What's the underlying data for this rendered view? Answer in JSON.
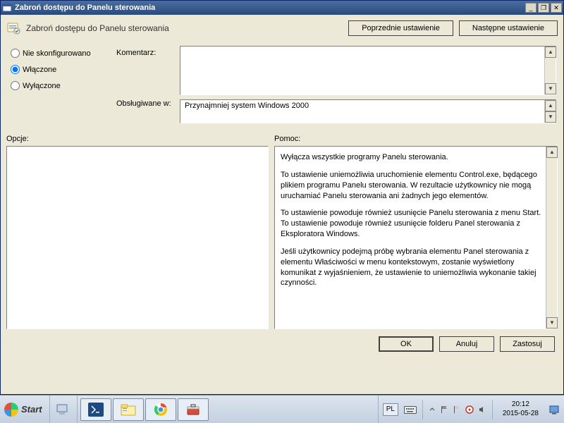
{
  "window": {
    "title": "Zabroń dostępu do Panelu sterowania"
  },
  "header": {
    "policy_title": "Zabroń dostępu do Panelu sterowania",
    "prev_btn": "Poprzednie ustawienie",
    "next_btn": "Następne ustawienie"
  },
  "state": {
    "option_not_configured": "Nie skonfigurowano",
    "option_enabled": "Włączone",
    "option_disabled": "Wyłączone",
    "selected": "enabled"
  },
  "labels": {
    "comment": "Komentarz:",
    "supported": "Obsługiwane w:",
    "options": "Opcje:",
    "help": "Pomoc:"
  },
  "supported_text": "Przynajmniej system Windows 2000",
  "help": {
    "p1": "Wyłącza wszystkie programy Panelu sterowania.",
    "p2": "To ustawienie uniemożliwia uruchomienie elementu Control.exe, będącego plikiem programu Panelu sterowania. W rezultacie użytkownicy nie mogą uruchamiać Panelu sterowania ani żadnych jego elementów.",
    "p3": "To ustawienie powoduje również usunięcie Panelu sterowania z menu Start. To ustawienie powoduje również usunięcie folderu Panel sterowania z Eksploratora Windows.",
    "p4": "Jeśli użytkownicy podejmą próbę wybrania elementu Panel sterowania z elementu Właściwości w menu kontekstowym, zostanie wyświetlony komunikat z wyjaśnieniem, że ustawienie to uniemożliwia wykonanie takiej czynności."
  },
  "buttons": {
    "ok": "OK",
    "cancel": "Anuluj",
    "apply": "Zastosuj"
  },
  "taskbar": {
    "start": "Start",
    "lang": "PL",
    "time": "20:12",
    "date": "2015-05-28"
  }
}
